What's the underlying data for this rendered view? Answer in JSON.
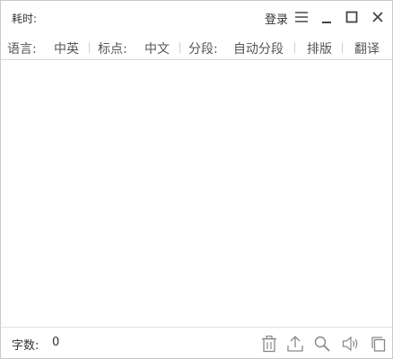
{
  "titlebar": {
    "elapsed_label": "耗时:",
    "login_label": "登录",
    "icons": [
      "menu-icon",
      "minimize-icon",
      "maximize-icon",
      "close-icon"
    ]
  },
  "toolbar": {
    "language_label": "语言:",
    "language_value": "中英",
    "punctuation_label": "标点:",
    "punctuation_value": "中文",
    "segment_label": "分段:",
    "segment_value": "自动分段",
    "layout_label": "排版",
    "translate_label": "翻译"
  },
  "editor": {
    "content": ""
  },
  "footer": {
    "count_label": "字数:",
    "count_value": "0",
    "icons": [
      "trash-icon",
      "upload-icon",
      "search-icon",
      "speaker-icon",
      "copy-icon"
    ]
  },
  "colors": {
    "border": "#c9c9c9",
    "text": "#333333",
    "toolbar_text": "#555555",
    "icon": "#888888"
  }
}
